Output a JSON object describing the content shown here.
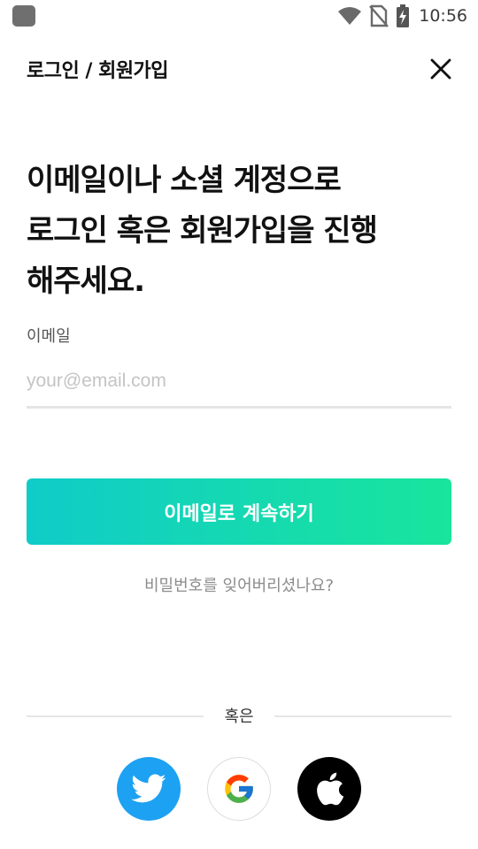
{
  "status_bar": {
    "time": "10:56",
    "icons": [
      "app-icon",
      "wifi-icon",
      "no-sim-icon",
      "battery-charging-icon"
    ]
  },
  "header": {
    "title": "로그인 / 회원가입",
    "close_icon": "close-icon"
  },
  "headline": {
    "lines": [
      "이메일이나 소셜 계정으로",
      "로그인 혹은 회원가입을 진행",
      "해주세요."
    ]
  },
  "email": {
    "label": "이메일",
    "placeholder": "your@email.com",
    "value": ""
  },
  "continue_button": {
    "label": "이메일로 계속하기"
  },
  "forgot_password": {
    "label": "비밀번호를 잊어버리셨나요?"
  },
  "divider": {
    "label": "혹은"
  },
  "social": {
    "buttons": [
      {
        "icon": "twitter-icon",
        "color": "#1DA1F2"
      },
      {
        "icon": "google-icon",
        "color": "#FFFFFF"
      },
      {
        "icon": "apple-icon",
        "color": "#000000"
      }
    ]
  },
  "colors": {
    "accent_start": "#10CCC8",
    "accent_end": "#19E59C",
    "text_primary": "#111111",
    "text_secondary": "#8C8C8C"
  }
}
